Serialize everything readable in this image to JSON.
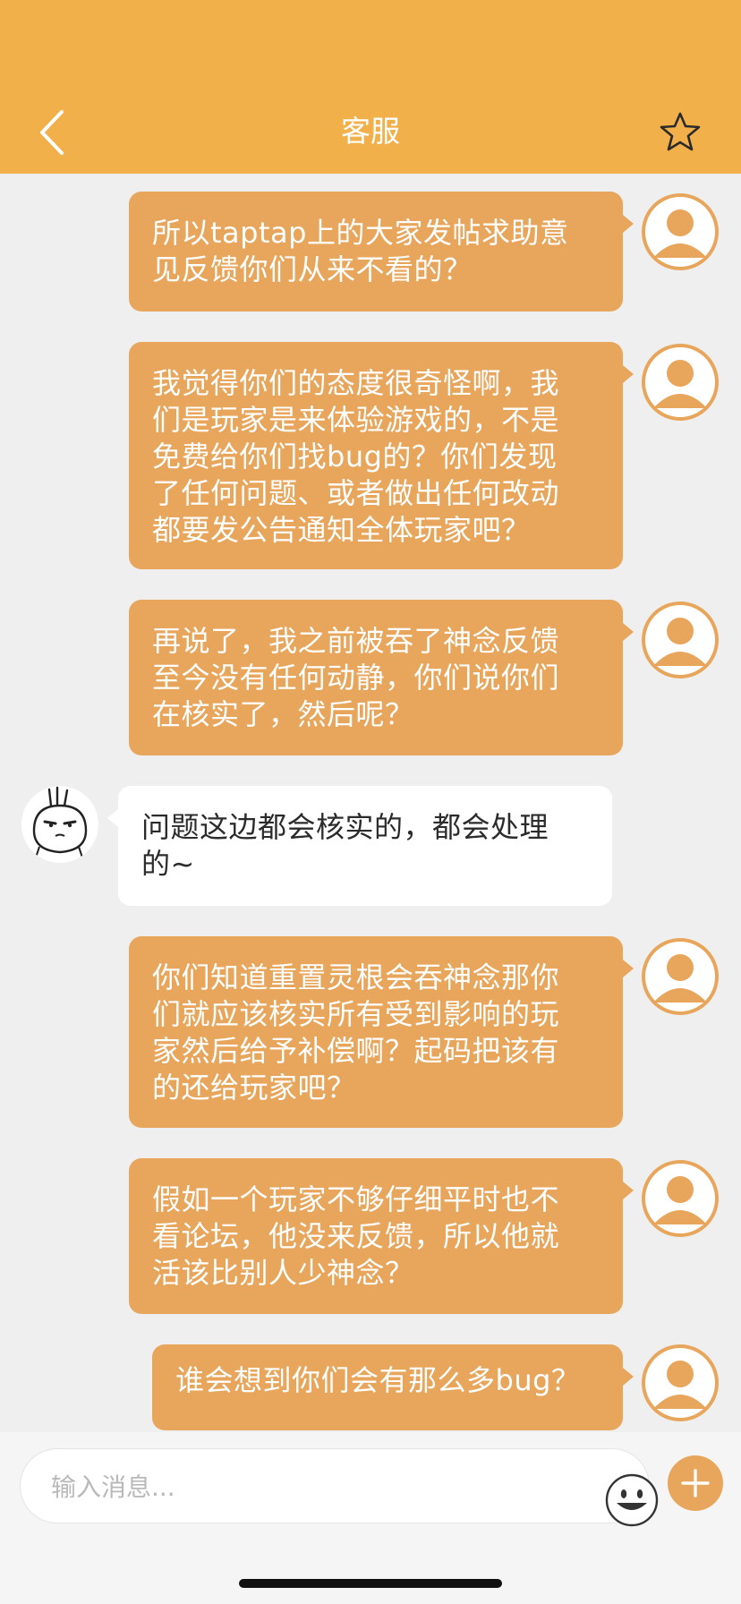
{
  "header": {
    "title": "客服",
    "background": "#f1b04a",
    "back_icon": "chevron-left-icon",
    "star_icon": "star-outline-icon"
  },
  "messages": [
    {
      "from": "user",
      "text": "所以taptap上的大家发帖求助意\n见反馈你们从来不看的？"
    },
    {
      "from": "user",
      "text": "我觉得你们的态度很奇怪啊，我\n们是玩家是来体验游戏的，不是\n免费给你们找bug的？你们发现\n了任何问题、或者做出任何改动\n都要发公告通知全体玩家吧？"
    },
    {
      "from": "user",
      "text": "再说了，我之前被吞了神念反馈\n至今没有任何动静，你们说你们\n在核实了，然后呢？"
    },
    {
      "from": "agent",
      "text": "问题这边都会核实的，都会处理\n的~"
    },
    {
      "from": "user",
      "text": "你们知道重置灵根会吞神念那你\n们就应该核实所有受到影响的玩\n家然后给予补偿啊？起码把该有\n的还给玩家吧？"
    },
    {
      "from": "user",
      "text": "假如一个玩家不够仔细平时也不\n看论坛，他没来反馈，所以他就\n活该比别人少神念？"
    },
    {
      "from": "user",
      "text": "谁会想到你们会有那么多bug？"
    }
  ],
  "input": {
    "placeholder": "输入消息...",
    "emoji_icon": "smiley-icon",
    "plus_icon": "plus-icon"
  },
  "colors": {
    "accent": "#e8a65c",
    "chat_background": "#efefef",
    "agent_bubble": "#ffffff"
  }
}
